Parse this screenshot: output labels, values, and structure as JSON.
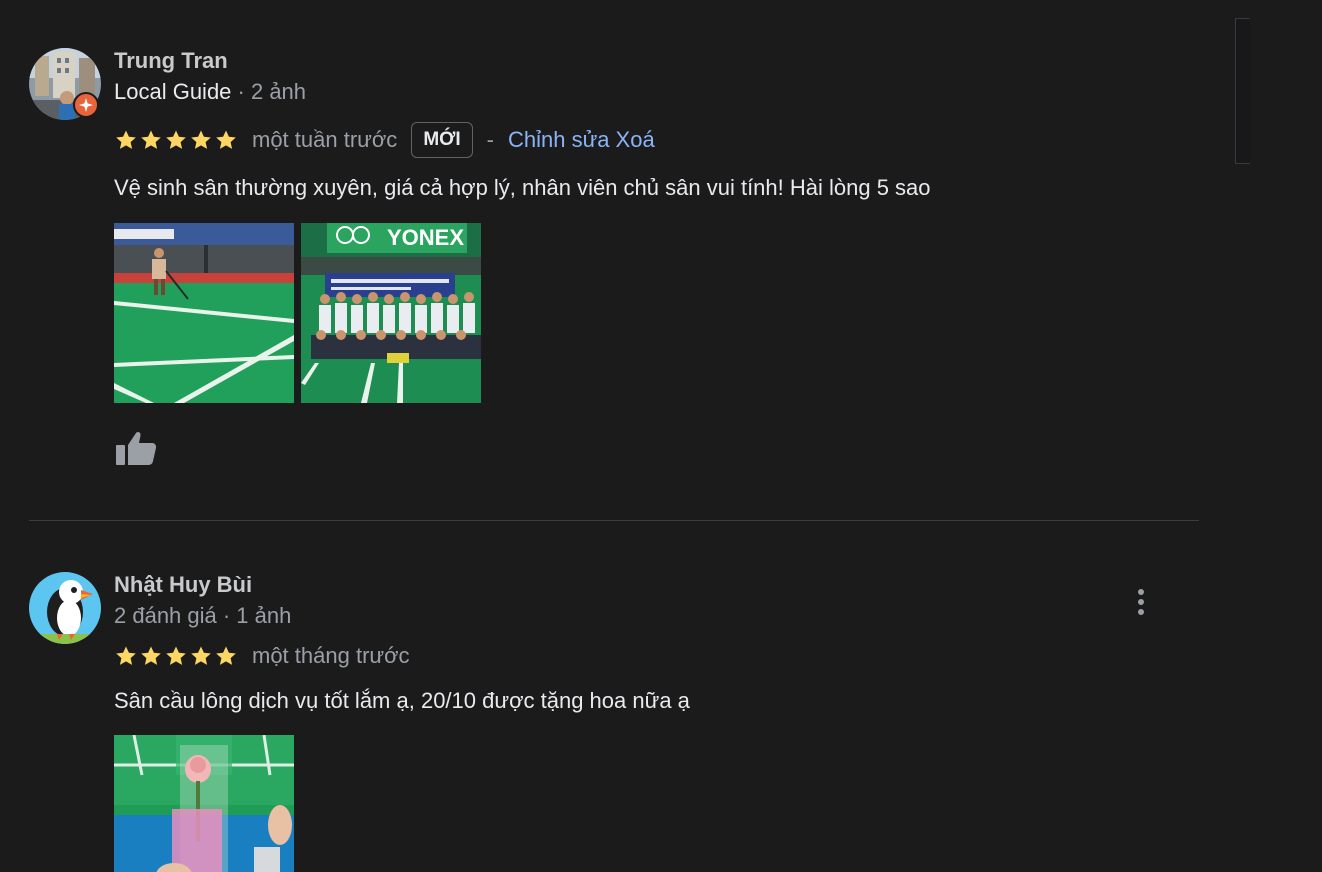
{
  "reviews": [
    {
      "author": "Trung Tran",
      "guide_label": "Local Guide",
      "meta_suffix": " · 2 ảnh",
      "rating": 5,
      "time": "một tuần trước",
      "new_badge": "MỚI",
      "dash": "-",
      "edit_label": "Chỉnh sửa",
      "delete_label": "Xoá",
      "text": "Vệ sinh sân thường xuyên, giá cả hợp lý, nhân viên chủ sân vui tính! Hài lòng 5 sao",
      "photo_brand_text": "YONEX"
    },
    {
      "author": "Nhật Huy Bùi",
      "meta": "2 đánh giá · 1 ảnh",
      "rating": 5,
      "time": "một tháng trước",
      "text": "Sân cầu lông dịch vụ tốt lắm ạ, 20/10 được tặng hoa nữa ạ"
    }
  ],
  "icons": {
    "star": "star-icon",
    "like": "thumbs-up-icon",
    "more": "more-vert-icon",
    "guide_badge": "local-guide-badge-icon"
  },
  "colors": {
    "background": "#1b1b1c",
    "star": "#fdd663",
    "link": "#8ab4f8",
    "secondary_text": "#9aa0a6",
    "court_green": "#1f9d57"
  }
}
